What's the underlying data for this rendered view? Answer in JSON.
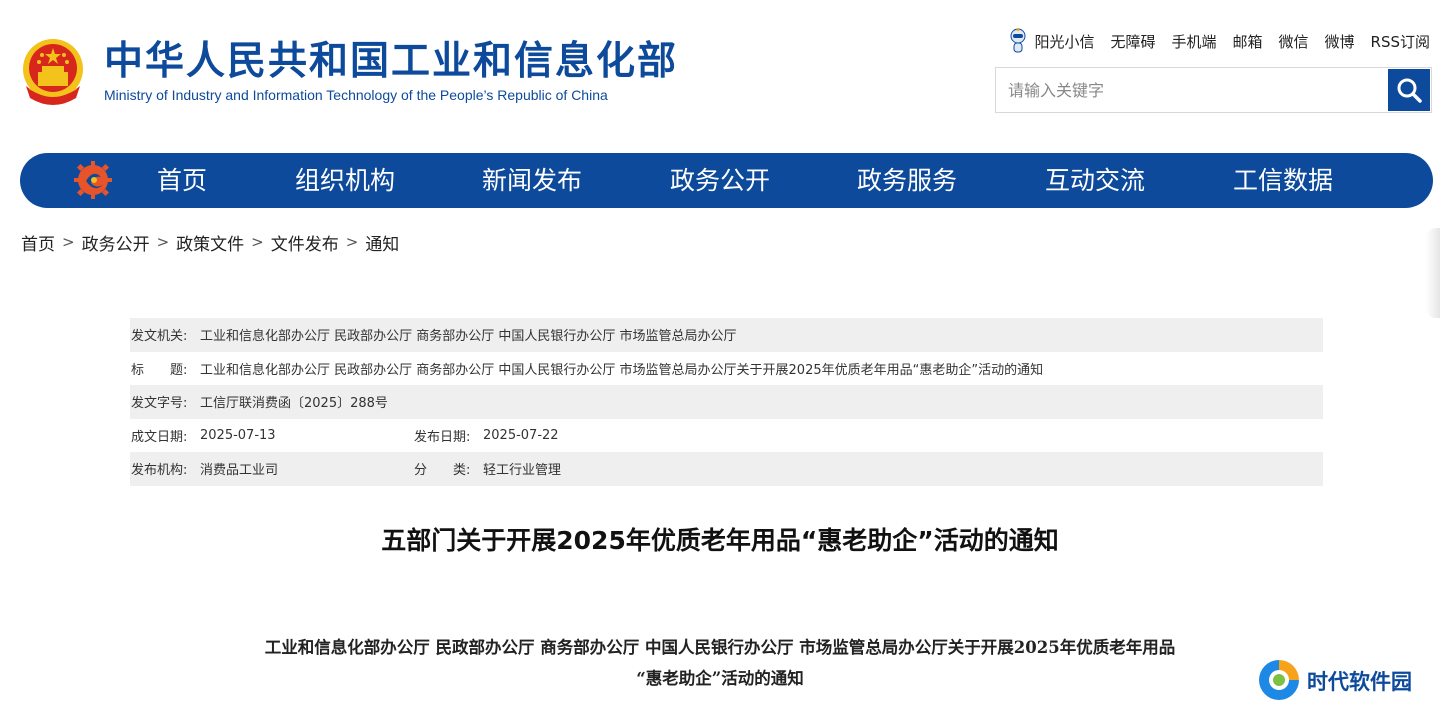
{
  "header": {
    "title_cn": "中华人民共和国工业和信息化部",
    "title_en": "Ministry of Industry and Information Technology of the People’s Republic of China",
    "top_links": [
      "阳光小信",
      "无障碍",
      "手机端",
      "邮箱",
      "微信",
      "微博",
      "RSS订阅"
    ],
    "search": {
      "placeholder": "请输入关键字",
      "value": ""
    },
    "icons": {
      "emblem": "national-emblem-icon",
      "robot": "robot-mascot-icon",
      "search": "search-icon"
    }
  },
  "nav": {
    "items": [
      "首页",
      "组织机构",
      "新闻发布",
      "政务公开",
      "政务服务",
      "互动交流",
      "工信数据"
    ],
    "logo": "miit-logo-icon",
    "background": "#0d4a9c"
  },
  "breadcrumb": [
    "首页",
    "政务公开",
    "政策文件",
    "文件发布",
    "通知"
  ],
  "meta": {
    "issuer": {
      "label": "发文机关:",
      "value": "工业和信息化部办公厅 民政部办公厅 商务部办公厅 中国人民银行办公厅 市场监管总局办公厅"
    },
    "title": {
      "label": "标　　题:",
      "value": "工业和信息化部办公厅 民政部办公厅 商务部办公厅 中国人民银行办公厅 市场监管总局办公厅关于开展2025年优质老年用品“惠老助企”活动的通知"
    },
    "doc_no": {
      "label": "发文字号:",
      "value": "工信厅联消费函〔2025〕288号"
    },
    "written_date": {
      "label": "成文日期:",
      "value": "2025-07-13"
    },
    "publish_date": {
      "label": "发布日期:",
      "value": "2025-07-22"
    },
    "publisher": {
      "label": "发布机构:",
      "value": "消费品工业司"
    },
    "category": {
      "label": "分　　类:",
      "value": "轻工行业管理"
    }
  },
  "document": {
    "title": "五部门关于开展2025年优质老年用品“惠老助企”活动的通知",
    "subtitle_line1": "工业和信息化部办公厅 民政部办公厅 商务部办公厅 中国人民银行办公厅 市场监管总局办公厅关于开展2025年优质老年用品",
    "subtitle_line2": "“惠老助企”活动的通知"
  },
  "watermark": {
    "text": "时代软件园",
    "icon": "site-logo-icon"
  },
  "colors": {
    "primary": "#0d4a9c",
    "shade": "#efefef",
    "emblem_red": "#d7261b",
    "emblem_gold": "#f3c21b"
  }
}
